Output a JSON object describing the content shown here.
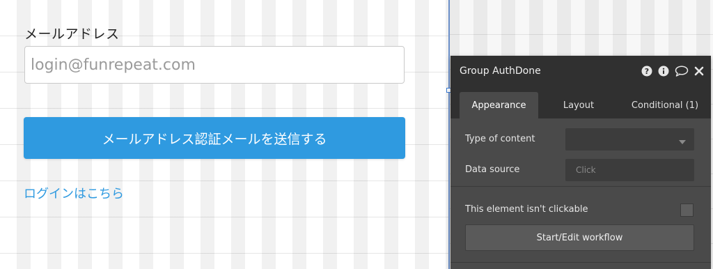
{
  "form": {
    "email_label": "メールアドレス",
    "email_placeholder": "login@funrepeat.com",
    "send_button_label": "メールアドレス認証メールを送信する",
    "login_link_label": "ログインはこちら"
  },
  "panel": {
    "title": "Group AuthDone",
    "header_icons": [
      "help-icon",
      "info-icon",
      "comment-icon",
      "close-icon"
    ],
    "tabs": [
      {
        "label": "Appearance",
        "active": true
      },
      {
        "label": "Layout",
        "active": false
      },
      {
        "label": "Conditional (1)",
        "active": false
      }
    ],
    "type_of_content_label": "Type of content",
    "type_of_content_value": "",
    "data_source_label": "Data source",
    "data_source_placeholder": "Click",
    "not_clickable_label": "This element isn't clickable",
    "not_clickable_checked": false,
    "workflow_button_label": "Start/Edit workflow"
  },
  "colors": {
    "primary_button": "#2f9ae0",
    "link": "#2f9ae0",
    "panel_bg": "#4a4a4a",
    "panel_header_bg": "#303030"
  }
}
